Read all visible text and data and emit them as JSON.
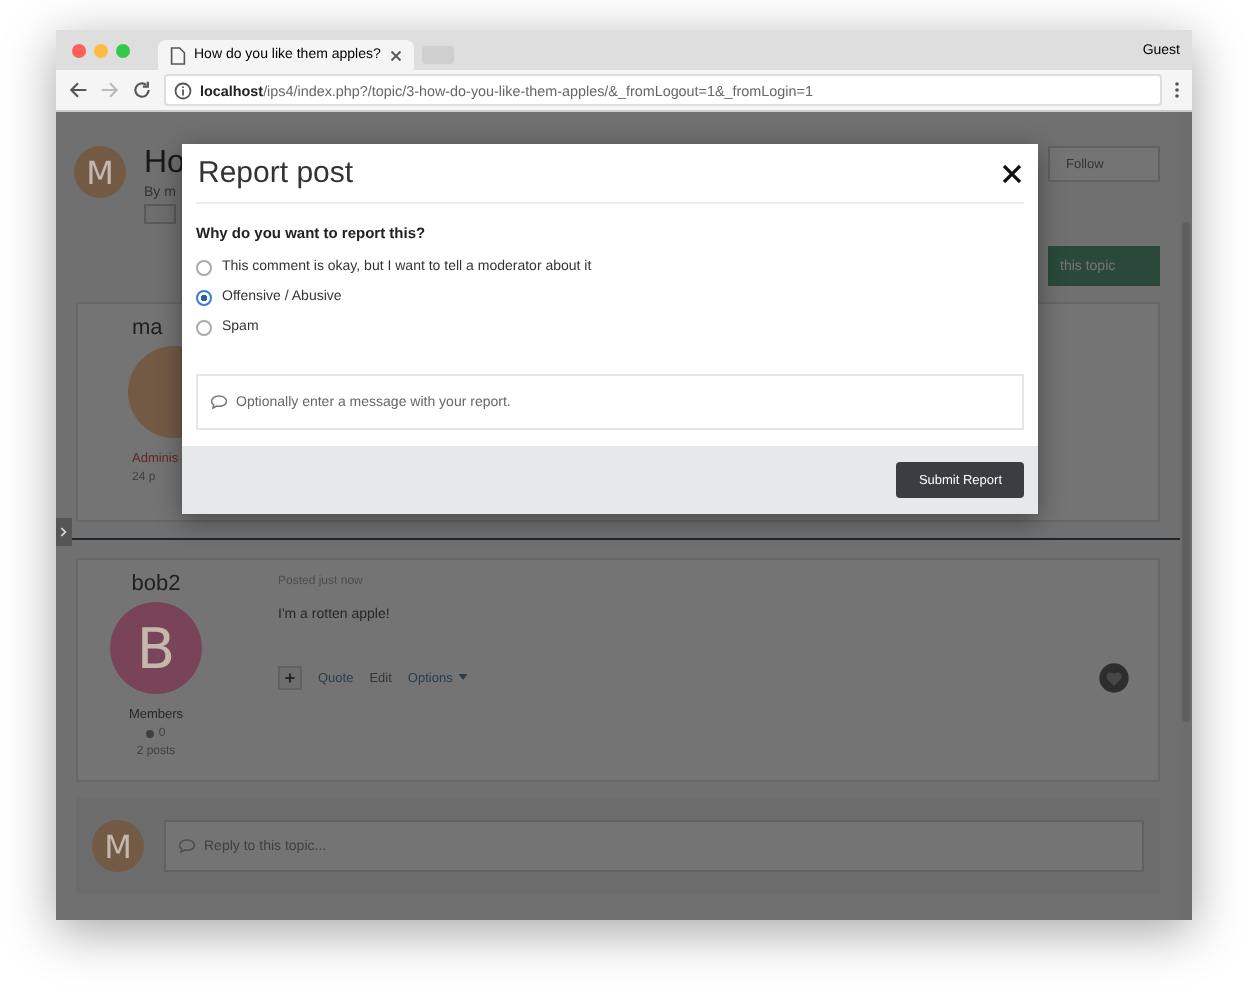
{
  "browser": {
    "tab_title": "How do you like them apples?",
    "profile": "Guest",
    "url_host": "localhost",
    "url_path": "/ips4/index.php?/topic/3-how-do-you-like-them-apples/&_fromLogout=1&_fromLogin=1"
  },
  "topic": {
    "avatar_letter": "M",
    "title": "Ho",
    "byline": "By m",
    "follow": "Follow",
    "reply_button": "this topic"
  },
  "posts": [
    {
      "kind": "covered",
      "author": "ma",
      "color": "#735a45",
      "group": "Adminis",
      "posts_count": "24 p"
    },
    {
      "kind": "full",
      "author": "bob2",
      "avatar_letter": "B",
      "color": "#7a4458",
      "posted": "Posted just now",
      "body": "I'm a rotten apple!",
      "group": "Members",
      "reputation": "0",
      "posts_count": "2 posts",
      "actions": [
        "Quote",
        "Edit",
        "Options"
      ]
    }
  ],
  "reply": {
    "avatar_letter": "M",
    "placeholder": "Reply to this topic..."
  },
  "modal": {
    "title": "Report post",
    "question": "Why do you want to report this?",
    "reasons": [
      {
        "label": "This comment is okay, but I want to tell a moderator about it",
        "selected": false
      },
      {
        "label": "Offensive / Abusive",
        "selected": true
      },
      {
        "label": "Spam",
        "selected": false
      }
    ],
    "message": {
      "placeholder": "Optionally enter a message with your report."
    },
    "submit": "Submit Report"
  }
}
